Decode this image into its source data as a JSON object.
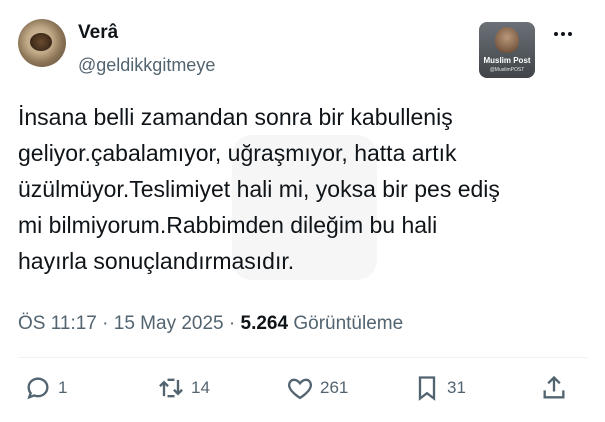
{
  "tweet": {
    "author": {
      "name": "Verâ",
      "handle": "@geldikkgitmeye"
    },
    "badge": {
      "title": "Muslim Post",
      "handle": "@MuslimPOST"
    },
    "text": "İnsana belli zamandan sonra bir kabulleniş\ngeliyor.çabalamıyor, uğraşmıyor, hatta artık\nüzülmüyor.Teslimiyet hali mi, yoksa bir pes ediş\nmi bilmiyorum.Rabbimden dileğim bu hali\nhayırla sonuçlandırmasıdır.",
    "time": "ÖS 11:17",
    "separator": "·",
    "date": "15 May 2025",
    "views_count": "5.264",
    "views_label": "Görüntüleme"
  },
  "actions": {
    "reply_count": "1",
    "retweet_count": "14",
    "like_count": "261",
    "bookmark_count": "31"
  },
  "icons": {
    "more": "more-icon",
    "reply": "reply-icon",
    "retweet": "retweet-icon",
    "like": "like-icon",
    "bookmark": "bookmark-icon",
    "share": "share-icon"
  },
  "colors": {
    "text": "#0f1419",
    "muted": "#536471",
    "divider": "#eff3f4"
  }
}
